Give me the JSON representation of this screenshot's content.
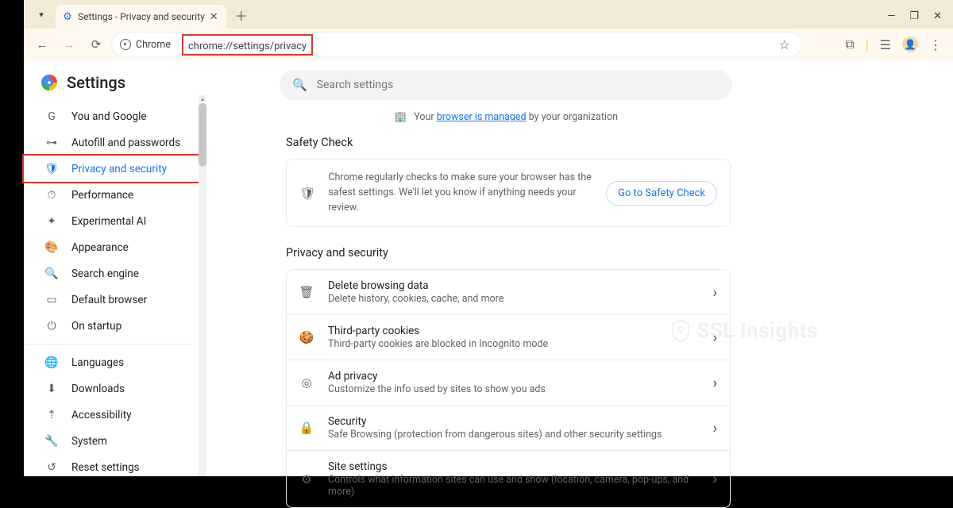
{
  "window": {
    "tab_title": "Settings - Privacy and security",
    "url": "chrome://settings/privacy",
    "chrome_chip": "Chrome"
  },
  "sidebar": {
    "title": "Settings",
    "items": [
      {
        "icon": "G",
        "label": "You and Google"
      },
      {
        "icon": "⊶",
        "label": "Autofill and passwords"
      },
      {
        "icon": "🛡",
        "label": "Privacy and security",
        "active": true
      },
      {
        "icon": "⏱",
        "label": "Performance"
      },
      {
        "icon": "✦",
        "label": "Experimental AI"
      },
      {
        "icon": "🎨",
        "label": "Appearance"
      },
      {
        "icon": "🔍",
        "label": "Search engine"
      },
      {
        "icon": "▭",
        "label": "Default browser"
      },
      {
        "icon": "⏻",
        "label": "On startup"
      },
      {
        "divider": true
      },
      {
        "icon": "🌐",
        "label": "Languages"
      },
      {
        "icon": "⬇",
        "label": "Downloads"
      },
      {
        "icon": "⇡",
        "label": "Accessibility"
      },
      {
        "icon": "🔧",
        "label": "System"
      },
      {
        "icon": "↺",
        "label": "Reset settings"
      }
    ]
  },
  "main": {
    "search_placeholder": "Search settings",
    "managed_prefix": "Your ",
    "managed_link": "browser is managed",
    "managed_suffix": " by your organization",
    "safety": {
      "heading": "Safety Check",
      "text": "Chrome regularly checks to make sure your browser has the safest settings. We'll let you know if anything needs your review.",
      "button": "Go to Safety Check"
    },
    "privacy": {
      "heading": "Privacy and security",
      "rows": [
        {
          "icon": "🗑",
          "title": "Delete browsing data",
          "sub": "Delete history, cookies, cache, and more"
        },
        {
          "icon": "🍪",
          "title": "Third-party cookies",
          "sub": "Third-party cookies are blocked in Incognito mode"
        },
        {
          "icon": "◎",
          "title": "Ad privacy",
          "sub": "Customize the info used by sites to show you ads"
        },
        {
          "icon": "🔒",
          "title": "Security",
          "sub": "Safe Browsing (protection from dangerous sites) and other security settings"
        },
        {
          "icon": "⚙",
          "title": "Site settings",
          "sub": "Controls what information sites can use and show (location, camera, pop-ups, and more)"
        }
      ]
    }
  },
  "watermark": "SSL Insights"
}
